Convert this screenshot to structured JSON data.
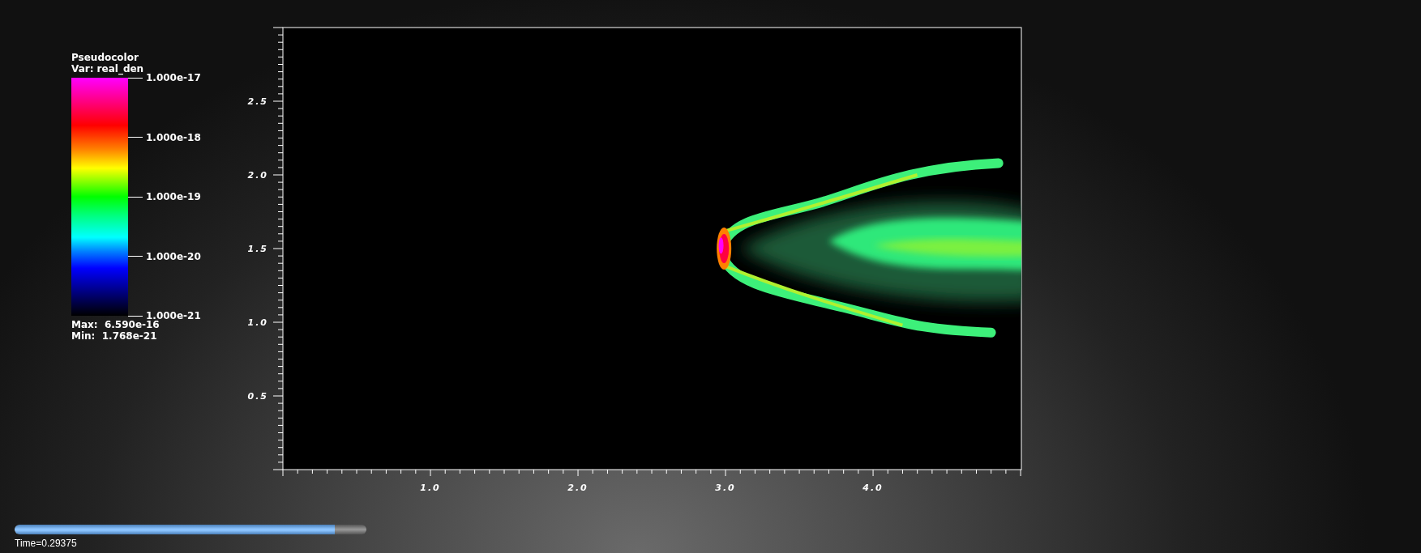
{
  "legend": {
    "title": "Pseudocolor",
    "variable": "Var: real_den",
    "ticks": [
      "1.000e-17",
      "1.000e-18",
      "1.000e-19",
      "1.000e-20",
      "1.000e-21"
    ],
    "max": "Max:  6.590e-16",
    "min": "Min:  1.768e-21"
  },
  "plot": {
    "x_ticks": [
      "1.0",
      "2.0",
      "3.0",
      "4.0"
    ],
    "y_ticks": [
      "2.5",
      "2.0",
      "1.5",
      "1.0",
      "0.5"
    ]
  },
  "time_slider": {
    "level": 0.91,
    "label": "Time=0.29375"
  }
}
